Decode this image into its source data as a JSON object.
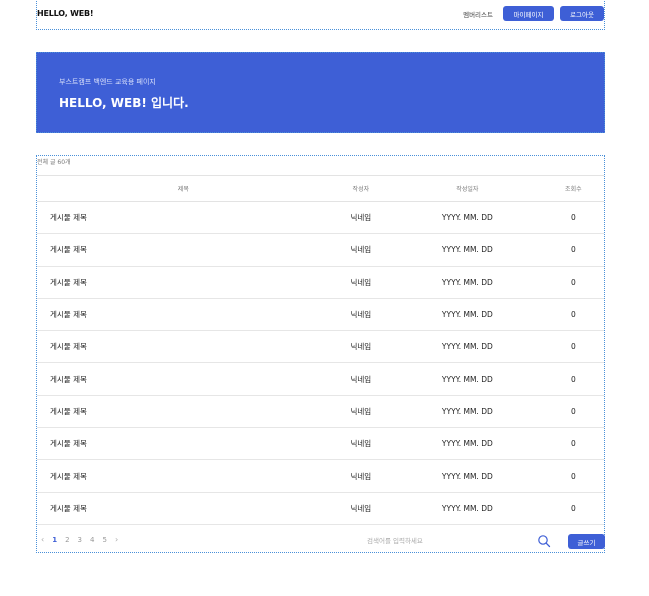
{
  "header": {
    "logo": "HELLO, WEB!",
    "member_list": "멤버리스트",
    "mypage": "마이페이지",
    "logout": "로그아웃"
  },
  "hero": {
    "subtitle": "부스트캠프 백엔드 교육용 페이지",
    "title": "HELLO, WEB! 입니다."
  },
  "board": {
    "count": "전체 글 60개",
    "columns": [
      "제목",
      "작성자",
      "작성일자",
      "조회수"
    ],
    "rows": [
      {
        "title": "게시물 제목",
        "author": "닉네임",
        "date": "YYYY. MM. DD",
        "views": "0"
      },
      {
        "title": "게시물 제목",
        "author": "닉네임",
        "date": "YYYY. MM. DD",
        "views": "0"
      },
      {
        "title": "게시물 제목",
        "author": "닉네임",
        "date": "YYYY. MM. DD",
        "views": "0"
      },
      {
        "title": "게시물 제목",
        "author": "닉네임",
        "date": "YYYY. MM. DD",
        "views": "0"
      },
      {
        "title": "게시물 제목",
        "author": "닉네임",
        "date": "YYYY. MM. DD",
        "views": "0"
      },
      {
        "title": "게시물 제목",
        "author": "닉네임",
        "date": "YYYY. MM. DD",
        "views": "0"
      },
      {
        "title": "게시물 제목",
        "author": "닉네임",
        "date": "YYYY. MM. DD",
        "views": "0"
      },
      {
        "title": "게시물 제목",
        "author": "닉네임",
        "date": "YYYY. MM. DD",
        "views": "0"
      },
      {
        "title": "게시물 제목",
        "author": "닉네임",
        "date": "YYYY. MM. DD",
        "views": "0"
      },
      {
        "title": "게시물 제목",
        "author": "닉네임",
        "date": "YYYY. MM. DD",
        "views": "0"
      }
    ]
  },
  "footer": {
    "pages": [
      "1",
      "2",
      "3",
      "4",
      "5"
    ],
    "active_page": "1",
    "search_placeholder": "검색어를 입력하세요",
    "write": "글쓰기"
  },
  "colors": {
    "accent": "#3e5fd6"
  },
  "icons": {
    "prev": "chevron-left-icon",
    "next": "chevron-right-icon",
    "search": "search-icon"
  }
}
